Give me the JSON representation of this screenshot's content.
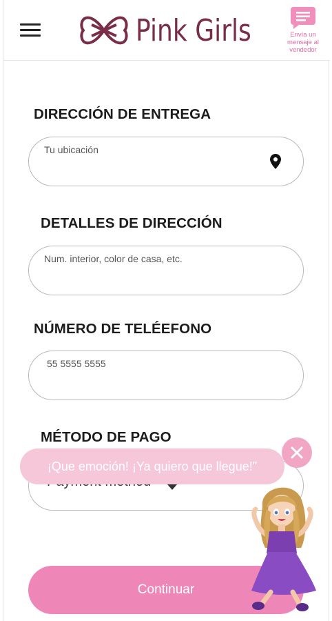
{
  "header": {
    "brand": "Pink Girls",
    "message_button": "Envía un mensaje al vendedor"
  },
  "form": {
    "delivery": {
      "title": "DIRECCIÓN DE ENTREGA",
      "placeholder": "Tu ubicación"
    },
    "details": {
      "title": "DETALLES DE DIRECCIÓN",
      "placeholder": "Num. interior, color de casa, etc."
    },
    "phone": {
      "title": "NÚMERO DE TELÉEFONO",
      "placeholder": "55 5555 5555"
    },
    "payment": {
      "title": "MÉTODO DE PAGO",
      "selected": "Payment method"
    }
  },
  "bubble": {
    "text": "¡Que emoción! ¡Ya quiero que llegue!\""
  },
  "continue_label": "Continuar",
  "colors": {
    "brand": "#7a2d49",
    "accent_pink": "#ef86b8",
    "bubble_pink": "#f6c7d9",
    "icon_pink": "#e26aa3"
  }
}
